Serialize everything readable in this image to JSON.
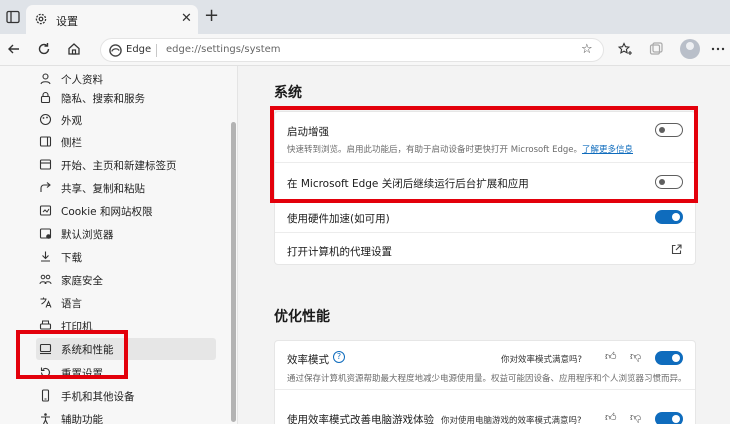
{
  "colors": {
    "accent": "#0f6cbd",
    "highlight": "#e3000b"
  },
  "tab": {
    "title": "设置",
    "icon": "gear-icon"
  },
  "address": {
    "site_label": "Edge",
    "url": "edge://settings/system"
  },
  "sidebar": {
    "items": [
      {
        "label": "个人资料",
        "icon": "profile-icon"
      },
      {
        "label": "隐私、搜索和服务",
        "icon": "lock-icon"
      },
      {
        "label": "外观",
        "icon": "appearance-icon"
      },
      {
        "label": "侧栏",
        "icon": "sidebar-icon"
      },
      {
        "label": "开始、主页和新建标签页",
        "icon": "home-icon"
      },
      {
        "label": "共享、复制和粘贴",
        "icon": "share-icon"
      },
      {
        "label": "Cookie 和网站权限",
        "icon": "cookie-icon"
      },
      {
        "label": "默认浏览器",
        "icon": "browser-icon"
      },
      {
        "label": "下载",
        "icon": "download-icon"
      },
      {
        "label": "家庭安全",
        "icon": "family-icon"
      },
      {
        "label": "语言",
        "icon": "language-icon"
      },
      {
        "label": "打印机",
        "icon": "printer-icon"
      },
      {
        "label": "系统和性能",
        "icon": "system-icon",
        "selected": true
      },
      {
        "label": "重置设置",
        "icon": "reset-icon"
      },
      {
        "label": "手机和其他设备",
        "icon": "phone-icon"
      },
      {
        "label": "辅助功能",
        "icon": "accessibility-icon"
      }
    ]
  },
  "system": {
    "title": "系统",
    "startup_boost": {
      "label": "启动增强",
      "description": "快速转到浏览。启用此功能后，有助于启动设备时更快打开 Microsoft Edge。",
      "link": "了解更多信息",
      "enabled": false
    },
    "background_ext": {
      "label": "在 Microsoft Edge 关闭后继续运行后台扩展和应用",
      "enabled": false
    },
    "hardware_accel": {
      "label": "使用硬件加速(如可用)",
      "enabled": true
    },
    "proxy": {
      "label": "打开计算机的代理设置"
    }
  },
  "performance": {
    "title": "优化性能",
    "efficiency_mode": {
      "label": "效率模式",
      "feedback": "你对效率模式满意吗?",
      "description": "通过保存计算机资源帮助最大程度地减少电源使用量。权益可能因设备、应用程序和个人浏览器习惯而异。",
      "enabled": true
    },
    "gaming": {
      "label": "使用效率模式改善电脑游戏体验",
      "feedback": "你对使用电脑游戏的效率模式满意吗?",
      "enabled": true
    }
  }
}
